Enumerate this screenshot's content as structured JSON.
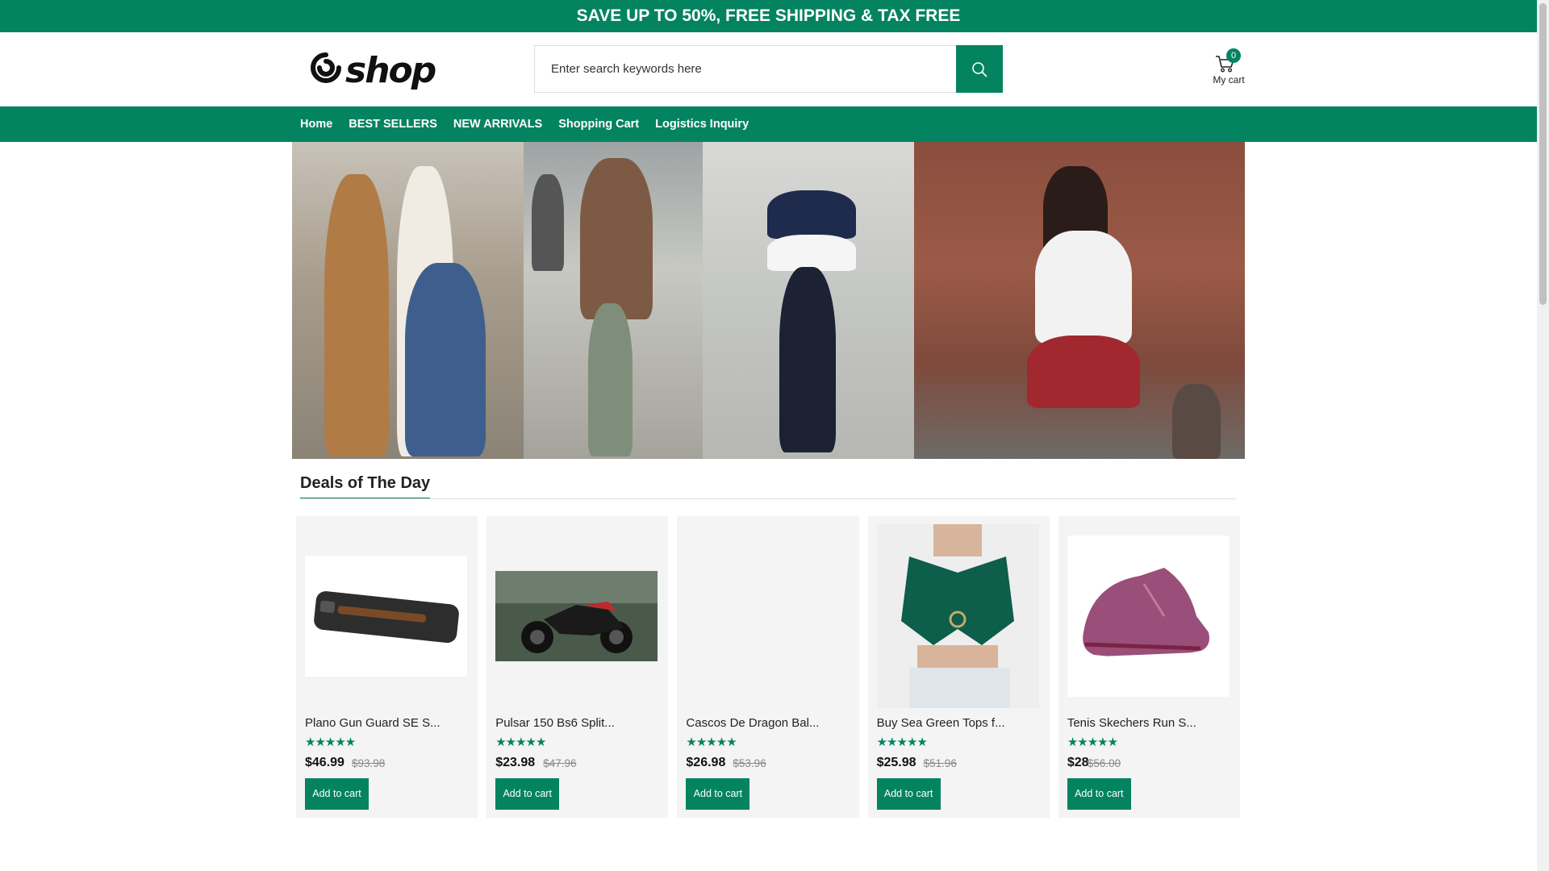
{
  "promo": {
    "text": "SAVE UP TO 50%, FREE SHIPPING & TAX FREE"
  },
  "header": {
    "logo_text": "shop",
    "search_placeholder": "Enter search keywords here",
    "cart_count": "0",
    "cart_label": "My cart"
  },
  "nav": {
    "items": [
      {
        "label": "Home"
      },
      {
        "label": "BEST SELLERS"
      },
      {
        "label": "NEW ARRIVALS"
      },
      {
        "label": "Shopping Cart"
      },
      {
        "label": "Logistics Inquiry"
      }
    ]
  },
  "deals": {
    "title": "Deals of The Day",
    "products": [
      {
        "name": "Plano Gun Guard SE S...",
        "rating": "★★★★★",
        "price": "$46.99",
        "old_price": "$93.98",
        "button": "Add to cart"
      },
      {
        "name": "Pulsar 150 Bs6 Split...",
        "rating": "★★★★★",
        "price": "$23.98",
        "old_price": "$47.96",
        "button": "Add to cart"
      },
      {
        "name": "Cascos De Dragon Bal...",
        "rating": "★★★★★",
        "price": "$26.98",
        "old_price": "$53.96",
        "button": "Add to cart"
      },
      {
        "name": "Buy Sea Green Tops f...",
        "rating": "★★★★★",
        "price": "$25.98",
        "old_price": "$51.96",
        "button": "Add to cart"
      },
      {
        "name": "Tenis Skechers Run S...",
        "rating": "★★★★★",
        "price": "$28",
        "old_price": "$56.00",
        "button": "Add to cart"
      }
    ]
  },
  "colors": {
    "brand": "#048360"
  }
}
